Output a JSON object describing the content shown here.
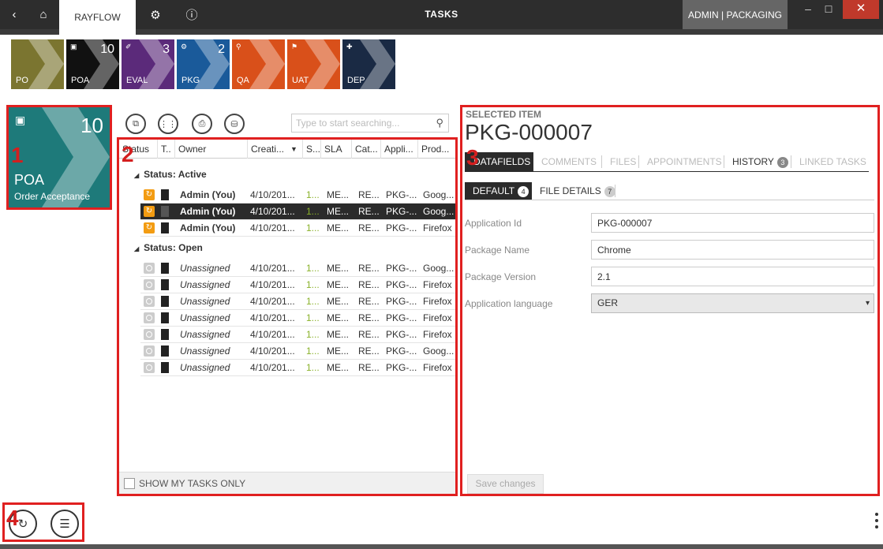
{
  "titlebar": {
    "tab_label": "RAYFLOW",
    "title": "TASKS",
    "user": "ADMIN | PACKAGING",
    "back_icon": "‹",
    "home_icon": "⌂",
    "gear_icon": "⚙",
    "info_icon": "ⓘ",
    "minimize_icon": "–",
    "maximize_icon": "☐",
    "close_icon": "✕"
  },
  "stages": [
    {
      "label": "PO",
      "count": "",
      "icon": "",
      "color": "#7b7530"
    },
    {
      "label": "POA",
      "count": "10",
      "icon": "▣",
      "color": "#111111"
    },
    {
      "label": "EVAL",
      "count": "3",
      "icon": "✐",
      "color": "#5b2a7a"
    },
    {
      "label": "PKG",
      "count": "2",
      "icon": "⚙",
      "color": "#1a5a9a"
    },
    {
      "label": "QA",
      "count": "",
      "icon": "⚲",
      "color": "#d9501a"
    },
    {
      "label": "UAT",
      "count": "",
      "icon": "⚑",
      "color": "#d9501a"
    },
    {
      "label": "DEP",
      "count": "",
      "icon": "✚",
      "color": "#1a2a44"
    }
  ],
  "selected_stage": {
    "count": "10",
    "icon": "▣",
    "title": "POA",
    "subtitle": "Order Acceptance",
    "color": "#1e7a7a"
  },
  "callouts": [
    "1",
    "2",
    "3",
    "4"
  ],
  "toolbar": {
    "icons": [
      "⧉",
      "⋮⋮",
      "⎙",
      "⛁"
    ],
    "search_placeholder": "Type to start searching...",
    "search_icon": "⚲"
  },
  "grid": {
    "columns": [
      "Status",
      "T..",
      "Owner",
      "Creati...",
      "S...",
      "SLA",
      "Cat...",
      "Appli...",
      "Prod..."
    ],
    "sort_icon": "▼",
    "groups": [
      {
        "label": "Status: Active",
        "rows": [
          {
            "status": "active",
            "owner": "Admin (You)",
            "created": "4/10/201...",
            "s": "1...",
            "sla": "ME...",
            "cat": "RE...",
            "app": "PKG-...",
            "prod": "Goog...",
            "selected": false
          },
          {
            "status": "active",
            "owner": "Admin (You)",
            "created": "4/10/201...",
            "s": "1...",
            "sla": "ME...",
            "cat": "RE...",
            "app": "PKG-...",
            "prod": "Goog...",
            "selected": true
          },
          {
            "status": "active",
            "owner": "Admin (You)",
            "created": "4/10/201...",
            "s": "1...",
            "sla": "ME...",
            "cat": "RE...",
            "app": "PKG-...",
            "prod": "Firefox",
            "selected": false
          }
        ]
      },
      {
        "label": "Status: Open",
        "rows": [
          {
            "status": "open",
            "owner": "Unassigned",
            "created": "4/10/201...",
            "s": "1...",
            "sla": "ME...",
            "cat": "RE...",
            "app": "PKG-...",
            "prod": "Goog...",
            "selected": false
          },
          {
            "status": "open",
            "owner": "Unassigned",
            "created": "4/10/201...",
            "s": "1...",
            "sla": "ME...",
            "cat": "RE...",
            "app": "PKG-...",
            "prod": "Firefox",
            "selected": false
          },
          {
            "status": "open",
            "owner": "Unassigned",
            "created": "4/10/201...",
            "s": "1...",
            "sla": "ME...",
            "cat": "RE...",
            "app": "PKG-...",
            "prod": "Firefox",
            "selected": false
          },
          {
            "status": "open",
            "owner": "Unassigned",
            "created": "4/10/201...",
            "s": "1...",
            "sla": "ME...",
            "cat": "RE...",
            "app": "PKG-...",
            "prod": "Firefox",
            "selected": false
          },
          {
            "status": "open",
            "owner": "Unassigned",
            "created": "4/10/201...",
            "s": "1...",
            "sla": "ME...",
            "cat": "RE...",
            "app": "PKG-...",
            "prod": "Firefox",
            "selected": false
          },
          {
            "status": "open",
            "owner": "Unassigned",
            "created": "4/10/201...",
            "s": "1...",
            "sla": "ME...",
            "cat": "RE...",
            "app": "PKG-...",
            "prod": "Goog...",
            "selected": false
          },
          {
            "status": "open",
            "owner": "Unassigned",
            "created": "4/10/201...",
            "s": "1...",
            "sla": "ME...",
            "cat": "RE...",
            "app": "PKG-...",
            "prod": "Firefox",
            "selected": false
          }
        ]
      }
    ],
    "show_mine_label": "SHOW MY TASKS ONLY",
    "active_status_icon": "↻"
  },
  "detail": {
    "selected_label": "SELECTED ITEM",
    "item_id": "PKG-000007",
    "tabs": [
      {
        "label": "DATAFIELDS",
        "badge": "",
        "active": true
      },
      {
        "label": "COMMENTS",
        "badge": "",
        "active": false
      },
      {
        "label": "FILES",
        "badge": "",
        "active": false
      },
      {
        "label": "APPOINTMENTS",
        "badge": "",
        "active": false
      },
      {
        "label": "HISTORY",
        "badge": "3",
        "active": false,
        "dark": true
      },
      {
        "label": "LINKED TASKS",
        "badge": "",
        "active": false
      }
    ],
    "subtabs": [
      {
        "label": "DEFAULT",
        "badge": "4",
        "active": true
      },
      {
        "label": "FILE DETAILS",
        "badge": "7",
        "active": false
      }
    ],
    "fields": [
      {
        "label": "Application Id",
        "value": "PKG-000007",
        "type": "text"
      },
      {
        "label": "Package Name",
        "value": "Chrome",
        "type": "text"
      },
      {
        "label": "Package Version",
        "value": "2.1",
        "type": "text"
      },
      {
        "label": "Application language",
        "value": "GER",
        "type": "select"
      }
    ],
    "select_arrow": "▾",
    "save_label": "Save changes"
  },
  "bottom": {
    "refresh_icon": "↻",
    "list_icon": "☰"
  }
}
